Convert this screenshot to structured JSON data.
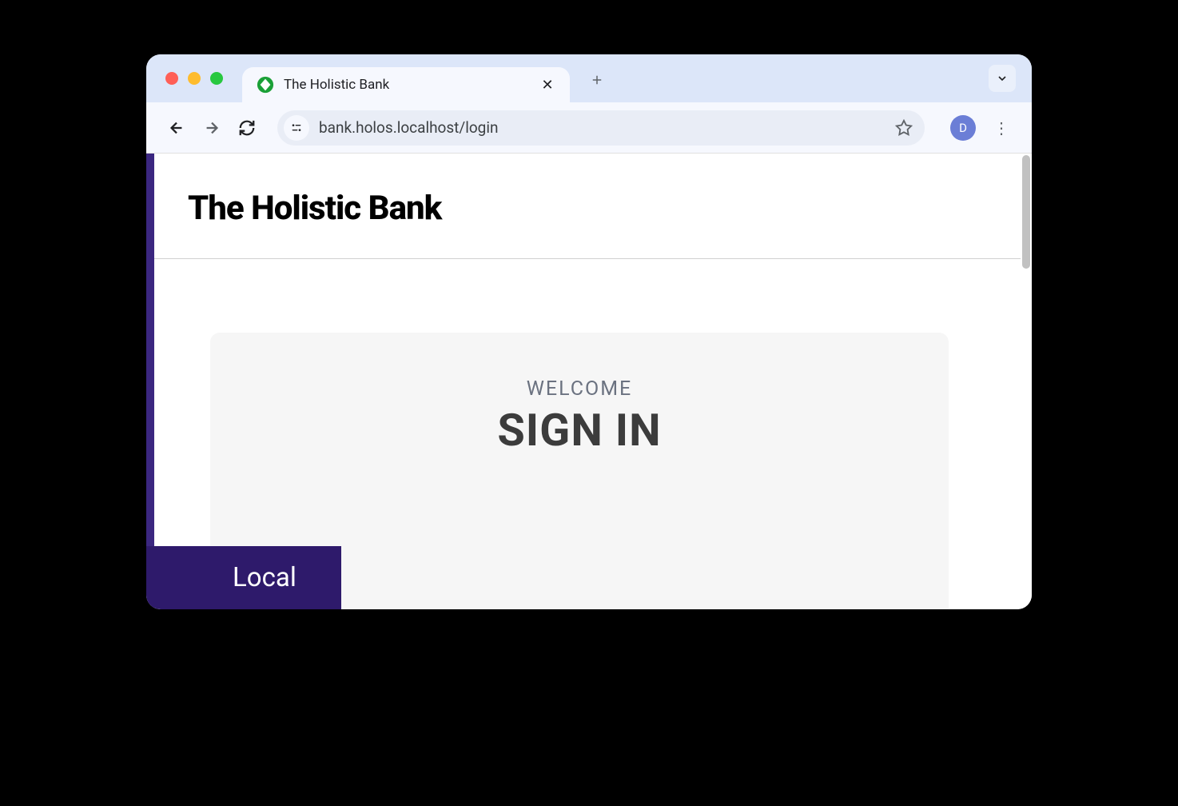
{
  "browser": {
    "tab_title": "The Holistic Bank",
    "url": "bank.holos.localhost/login",
    "profile_initial": "D"
  },
  "page": {
    "header_title": "The Holistic Bank",
    "welcome_label": "WELCOME",
    "signin_label": "SIGN IN",
    "env_badge": "Local"
  }
}
